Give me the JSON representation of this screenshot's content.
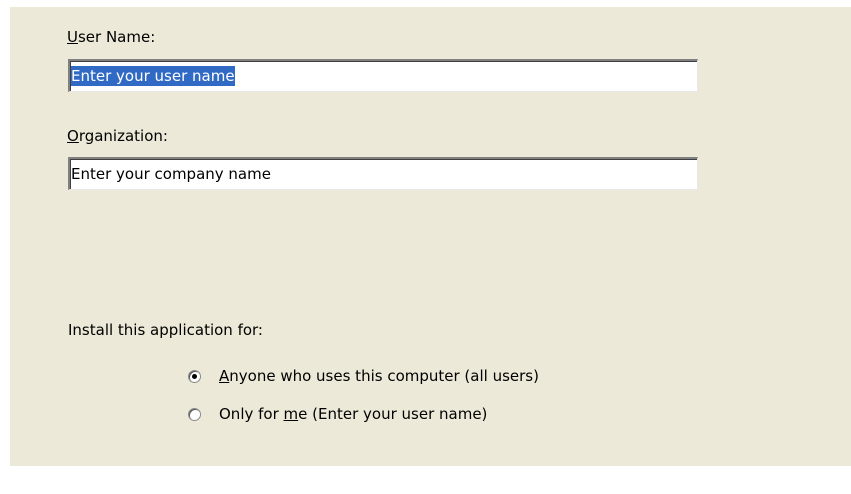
{
  "user_name": {
    "label_accel": "U",
    "label_rest": "ser Name:",
    "value": "Enter your user name"
  },
  "organization": {
    "label_accel": "O",
    "label_rest": "rganization:",
    "value": "Enter your company name"
  },
  "install_for": {
    "label": "Install this application for:",
    "options": [
      {
        "pre": "",
        "accel": "A",
        "post": "nyone who uses this computer (all users)",
        "selected": true
      },
      {
        "pre": "Only for ",
        "accel": "m",
        "post": "e (Enter your user name)",
        "selected": false
      }
    ]
  }
}
